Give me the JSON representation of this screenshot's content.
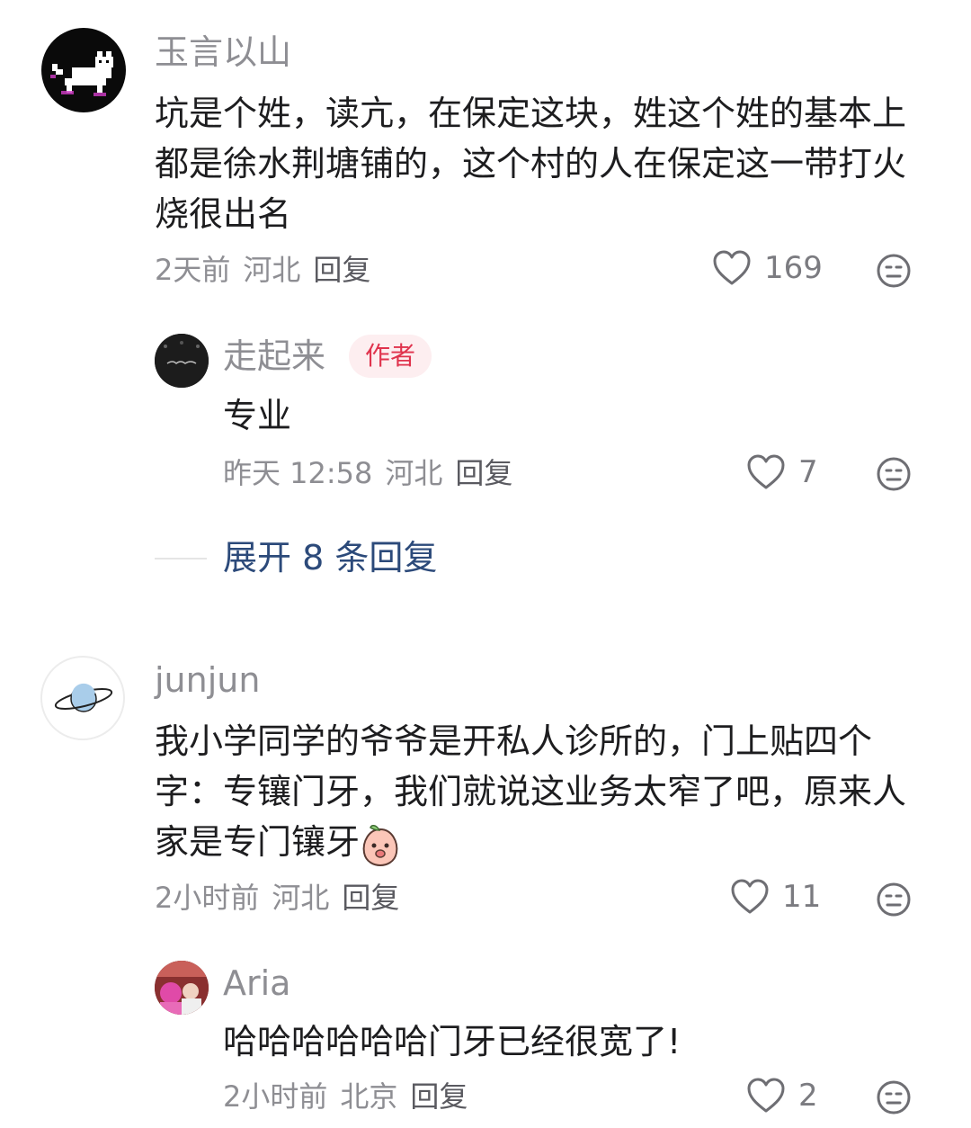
{
  "comments": [
    {
      "user": "玉言以山",
      "text": "坑是个姓，读亢，在保定这块，姓这个姓的基本上都是徐水荆塘铺的，这个村的人在保定这一带打火烧很出名",
      "time": "2天前",
      "location": "河北",
      "reply_label": "回复",
      "likes": "169",
      "replies": [
        {
          "user": "走起来",
          "badge": "作者",
          "text": "专业",
          "time": "昨天 12:58",
          "location": "河北",
          "reply_label": "回复",
          "likes": "7"
        }
      ],
      "expand_label": "展开 8 条回复"
    },
    {
      "user": "junjun",
      "text": "我小学同学的爷爷是开私人诊所的，门上贴四个字：专镶门牙，我们就说这业务太窄了吧，原来人家是专门镶牙",
      "time": "2小时前",
      "location": "河北",
      "reply_label": "回复",
      "likes": "11",
      "replies": [
        {
          "user": "Aria",
          "text": "哈哈哈哈哈哈门牙已经很宽了!",
          "time": "2小时前",
          "location": "北京",
          "reply_label": "回复",
          "likes": "2"
        }
      ]
    }
  ],
  "colors": {
    "name": "#8e8e93",
    "text": "#1d1d1f",
    "badge_bg": "#fdeef0",
    "badge_text": "#e0334d",
    "expand": "#2c4a7a"
  },
  "icons": {
    "like": "heart-outline-icon",
    "more": "meh-face-icon"
  }
}
